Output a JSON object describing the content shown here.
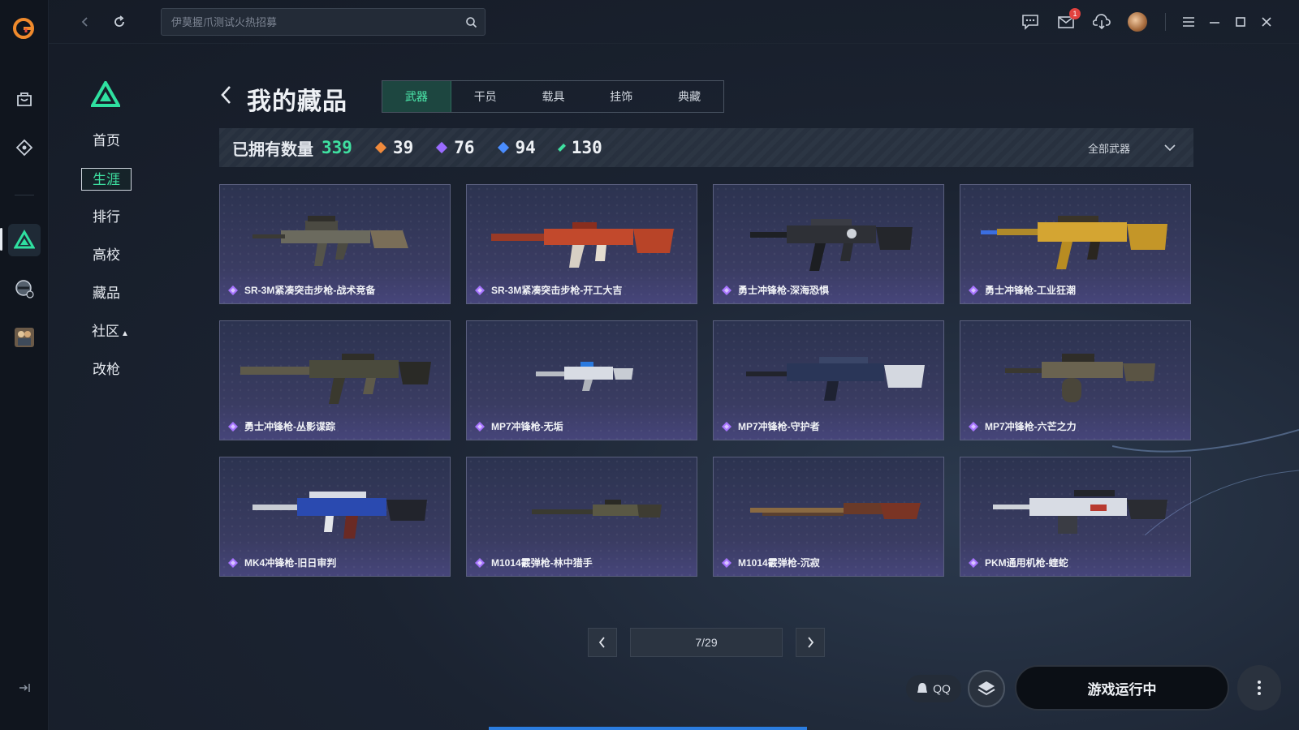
{
  "search": {
    "placeholder": "伊莫握爪测试火热招募"
  },
  "topbar": {
    "mail_badge": "1"
  },
  "subnav": {
    "items": [
      {
        "label": "首页"
      },
      {
        "label": "生涯"
      },
      {
        "label": "排行"
      },
      {
        "label": "高校"
      },
      {
        "label": "藏品"
      },
      {
        "label": "社区"
      },
      {
        "label": "改枪"
      }
    ],
    "active_index": 1
  },
  "main": {
    "title": "我的藏品",
    "tabs": [
      {
        "label": "武器"
      },
      {
        "label": "干员"
      },
      {
        "label": "载具"
      },
      {
        "label": "挂饰"
      },
      {
        "label": "典藏"
      }
    ],
    "active_tab": 0,
    "stats": {
      "label": "已拥有数量",
      "total": "339",
      "items": [
        {
          "value": "39",
          "color": "#f08a3c"
        },
        {
          "value": "76",
          "color": "#9a6bff"
        },
        {
          "value": "94",
          "color": "#4a8dff"
        },
        {
          "value": "130",
          "color": "#3fe0a0"
        }
      ]
    },
    "filter": {
      "label": "全部武器"
    },
    "cards": [
      {
        "name": "SR-3M紧凑突击步枪-战术竞备",
        "rarity_color": "#a774ff",
        "icon": "rifle-camo-icon"
      },
      {
        "name": "SR-3M紧凑突击步枪-开工大吉",
        "rarity_color": "#a774ff",
        "icon": "rifle-red-icon"
      },
      {
        "name": "勇士冲锋枪-深海恐惧",
        "rarity_color": "#a774ff",
        "icon": "smg-black-icon"
      },
      {
        "name": "勇士冲锋枪-工业狂潮",
        "rarity_color": "#a774ff",
        "icon": "smg-gold-icon"
      },
      {
        "name": "勇士冲锋枪-丛影谍踪",
        "rarity_color": "#a774ff",
        "icon": "smg-camo-icon"
      },
      {
        "name": "MP7冲锋枪-无垢",
        "rarity_color": "#a774ff",
        "icon": "mp7-white-icon"
      },
      {
        "name": "MP7冲锋枪-守护者",
        "rarity_color": "#a774ff",
        "icon": "mp7-navy-icon"
      },
      {
        "name": "MP7冲锋枪-六芒之力",
        "rarity_color": "#a774ff",
        "icon": "mp7-drum-icon"
      },
      {
        "name": "MK4冲锋枪-旧日审判",
        "rarity_color": "#a774ff",
        "icon": "mk4-blue-icon"
      },
      {
        "name": "M1014霰弹枪-林中猎手",
        "rarity_color": "#a774ff",
        "icon": "shotgun-camo-icon"
      },
      {
        "name": "M1014霰弹枪-沉寂",
        "rarity_color": "#a774ff",
        "icon": "shotgun-wood-icon"
      },
      {
        "name": "PKM通用机枪-蝰蛇",
        "rarity_color": "#a774ff",
        "icon": "lmg-white-icon"
      }
    ],
    "pagination": {
      "current": "7/29"
    }
  },
  "footer": {
    "qq_label": "QQ",
    "launch_label": "游戏运行中"
  },
  "colors": {
    "accent": "#3fe0a0",
    "rarity_purple": "#a774ff",
    "tab_active_bg": "#1d4640"
  }
}
